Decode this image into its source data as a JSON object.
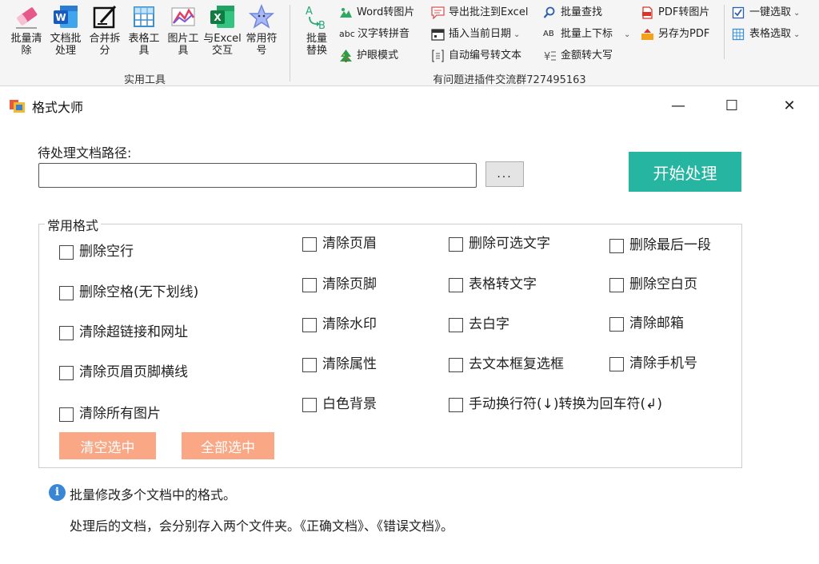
{
  "ribbon": {
    "tools_group": [
      {
        "id": "batch-clear",
        "label": "批量清\n除",
        "icon": "eraser-icon"
      },
      {
        "id": "doc-batch",
        "label": "文档批\n处理",
        "icon": "word-icon"
      },
      {
        "id": "merge-split",
        "label": "合并拆\n分",
        "icon": "edit-doc-icon"
      },
      {
        "id": "table-tools",
        "label": "表格工\n具",
        "icon": "table-icon"
      },
      {
        "id": "image-tools",
        "label": "图片工\n具",
        "icon": "chart-icon"
      },
      {
        "id": "excel-interact",
        "label": "与Excel\n交互",
        "icon": "excel-icon"
      },
      {
        "id": "common-symbols",
        "label": "常用符\n号",
        "icon": "star-icon"
      }
    ],
    "tools_group_label": "实用工具",
    "batch_replace": {
      "label": "批量\n替换",
      "icon_letters": "A B"
    },
    "small": {
      "word_to_image": "Word转图片",
      "hanzi_pinyin": "汉字转拼音",
      "eye_mode": "护眼模式",
      "export_comments": "导出批注到Excel",
      "insert_date": "插入当前日期",
      "auto_number": "自动编号转文本",
      "batch_find": "批量查找",
      "batch_superscript": "批量上下标",
      "amount_upper": "金额转大写",
      "pdf_to_image": "PDF转图片",
      "save_pdf": "另存为PDF",
      "select_one_key": "一键选取",
      "table_select": "表格选取",
      "abc_prefix": "abc",
      "ab_prefix": "AB"
    },
    "group2_label": "有问题进插件交流群727495163"
  },
  "window": {
    "title": "格式大师",
    "minimize": "—",
    "maximize": "☐",
    "close": "✕"
  },
  "form": {
    "path_label": "待处理文档路径:",
    "path_value": "",
    "browse_label": "...",
    "start_label": "开始处理",
    "group_title": "常用格式",
    "checkboxes": {
      "c1": "删除空行",
      "c2": "删除空格(无下划线)",
      "c3": "清除超链接和网址",
      "c4": "清除页眉页脚横线",
      "c5": "清除所有图片",
      "c6": "清除页眉",
      "c7": "清除页脚",
      "c8": "清除水印",
      "c9": "清除属性",
      "c10": "白色背景",
      "c11": "删除可选文字",
      "c12": "表格转文字",
      "c13": "去白字",
      "c14": "去文本框复选框",
      "c15": "手动换行符(↓)转换为回车符(↲)",
      "c16": "删除最后一段",
      "c17": "删除空白页",
      "c18": "清除邮箱",
      "c19": "清除手机号"
    },
    "clear_selection": "清空选中",
    "select_all": "全部选中"
  },
  "info": {
    "icon_letter": "i",
    "line1": "批量修改多个文档中的格式。",
    "line2": "处理后的文档，会分别存入两个文件夹。《正确文档》、《错误文档》。"
  },
  "colors": {
    "start_button": "#26b5a1",
    "salmon_button": "#f9a784",
    "info_icon": "#3a86d6"
  }
}
